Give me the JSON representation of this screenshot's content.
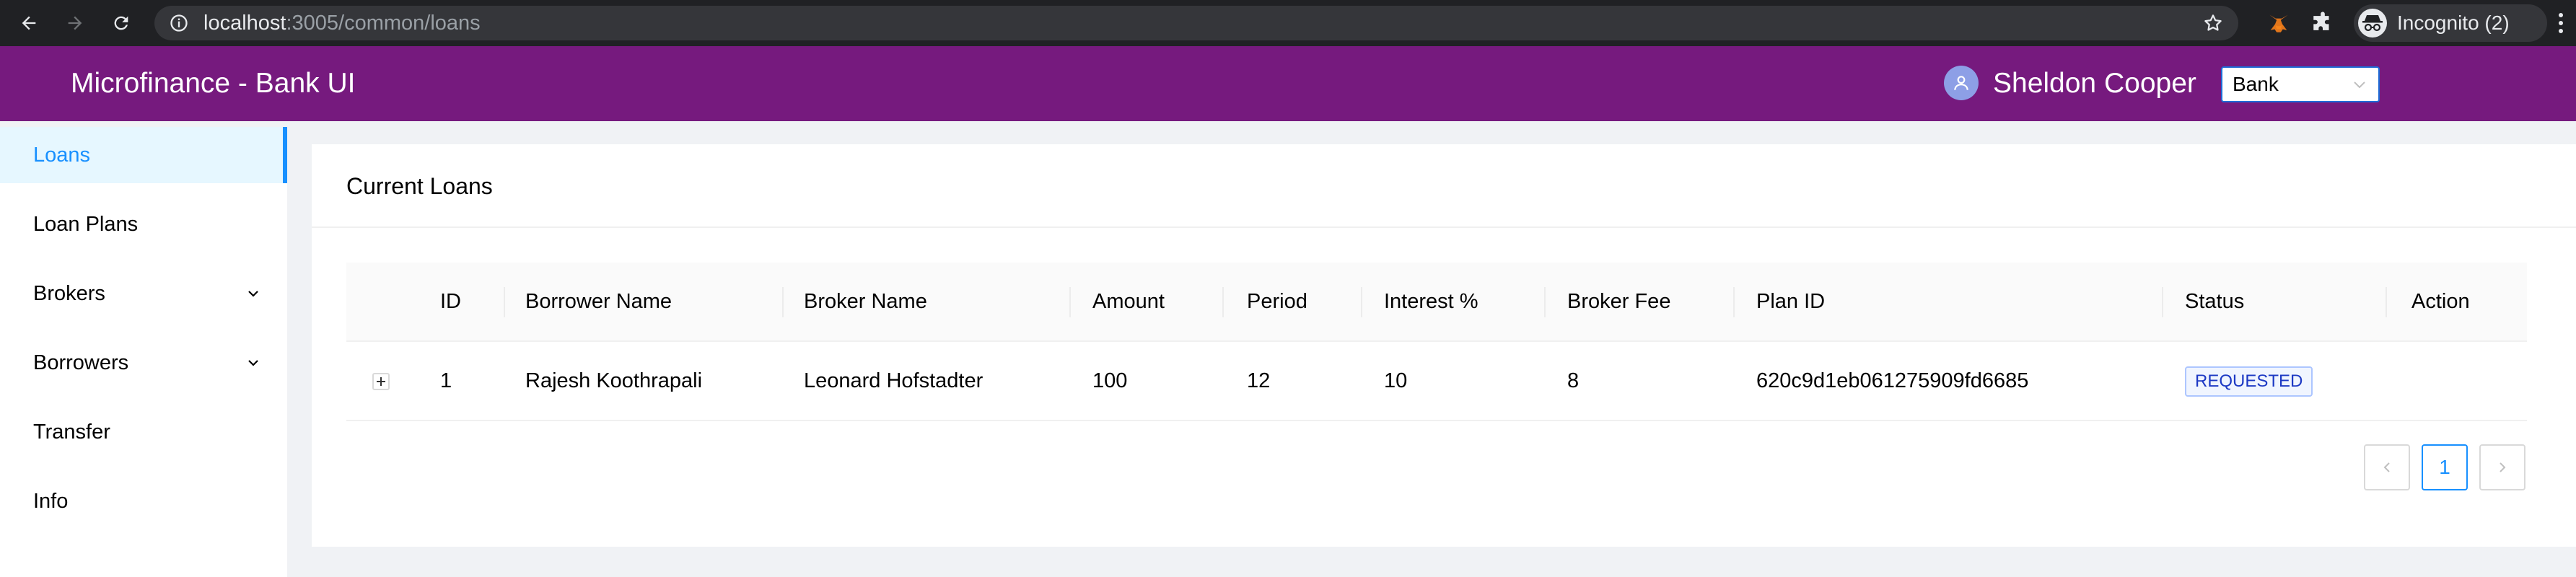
{
  "browser": {
    "url_host": "localhost",
    "url_path": ":3005/common/loans",
    "profile_label": "Incognito (2)"
  },
  "header": {
    "title": "Microfinance - Bank UI",
    "user_name": "Sheldon Cooper",
    "role_select": "Bank"
  },
  "sidebar": {
    "items": [
      {
        "label": "Loans",
        "active": true
      },
      {
        "label": "Loan Plans"
      },
      {
        "label": "Brokers",
        "expandable": true
      },
      {
        "label": "Borrowers",
        "expandable": true
      },
      {
        "label": "Transfer"
      },
      {
        "label": "Info"
      }
    ]
  },
  "main": {
    "title": "Current Loans",
    "columns": [
      "ID",
      "Borrower Name",
      "Broker Name",
      "Amount",
      "Period",
      "Interest %",
      "Broker Fee",
      "Plan ID",
      "Status",
      "Action"
    ],
    "rows": [
      {
        "id": "1",
        "borrower": "Rajesh Koothrapali",
        "broker": "Leonard Hofstadter",
        "amount": "100",
        "period": "12",
        "interest": "10",
        "broker_fee": "8",
        "plan_id": "620c9d1eb061275909fd6685",
        "status": "REQUESTED",
        "action": ""
      }
    ],
    "pagination": {
      "current_page": "1"
    }
  },
  "colors": {
    "header_bg": "#761a7e",
    "accent": "#1890ff",
    "status_tag_text": "#1d39c4"
  }
}
